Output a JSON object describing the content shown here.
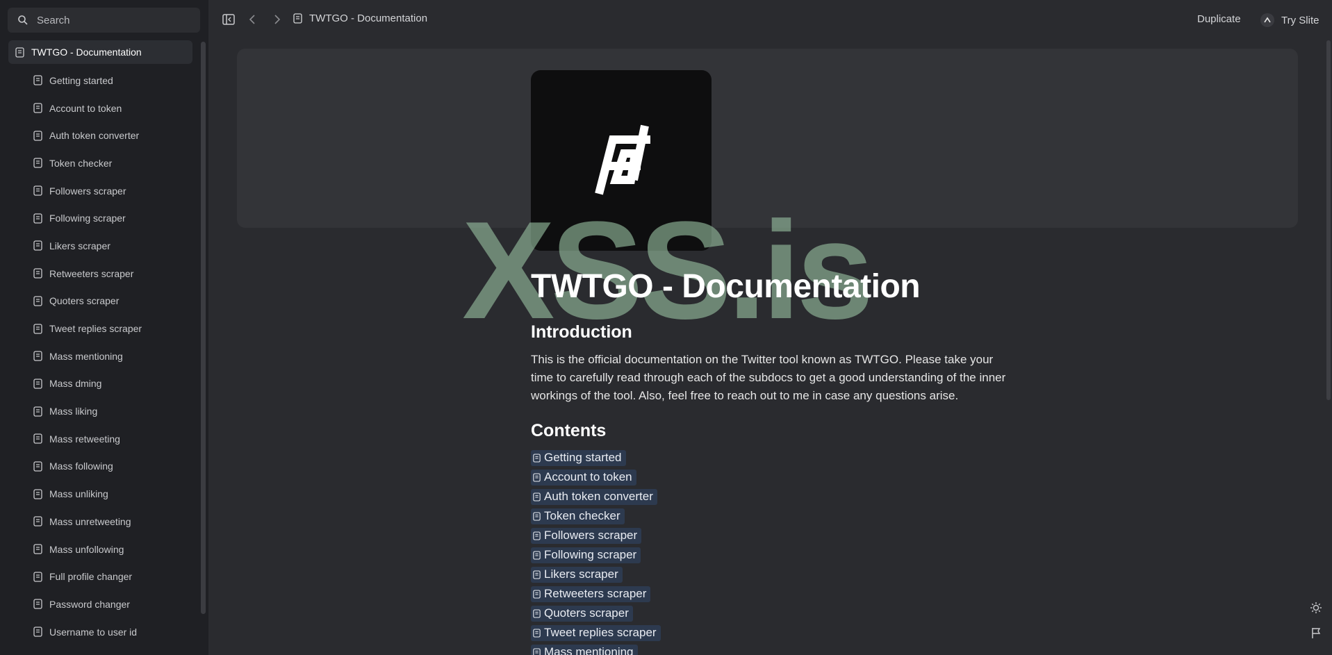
{
  "sidebar": {
    "search_placeholder": "Search",
    "root": {
      "label": "TWTGO - Documentation"
    },
    "items": [
      {
        "label": "Getting started"
      },
      {
        "label": "Account to token"
      },
      {
        "label": "Auth token converter"
      },
      {
        "label": "Token checker"
      },
      {
        "label": "Followers scraper"
      },
      {
        "label": "Following scraper"
      },
      {
        "label": "Likers scraper"
      },
      {
        "label": "Retweeters scraper"
      },
      {
        "label": "Quoters scraper"
      },
      {
        "label": "Tweet replies scraper"
      },
      {
        "label": "Mass mentioning"
      },
      {
        "label": "Mass dming"
      },
      {
        "label": "Mass liking"
      },
      {
        "label": "Mass retweeting"
      },
      {
        "label": "Mass following"
      },
      {
        "label": "Mass unliking"
      },
      {
        "label": "Mass unretweeting"
      },
      {
        "label": "Mass unfollowing"
      },
      {
        "label": "Full profile changer"
      },
      {
        "label": "Password changer"
      },
      {
        "label": "Username to user id"
      }
    ]
  },
  "topbar": {
    "breadcrumb": "TWTGO - Documentation",
    "duplicate_label": "Duplicate",
    "try_label": "Try Slite",
    "icons": [
      "sidebar-toggle-icon",
      "back-arrow-icon",
      "forward-arrow-icon",
      "document-icon"
    ]
  },
  "page": {
    "watermark": "XSS.is",
    "title": "TWTGO - Documentation",
    "intro_heading": "Introduction",
    "intro_text_1": "This is the official documentation on the Twitter tool known as TWTGO. Please take your time to carefully read through each of the subdocs to get a good understanding of the inner workings of the tool. Also, feel free to reach out to ",
    "intro_link": "me",
    "intro_text_2": " in case any questions arise.",
    "contents_heading": "Contents",
    "contents": [
      {
        "label": "Getting started"
      },
      {
        "label": "Account to token"
      },
      {
        "label": "Auth token converter"
      },
      {
        "label": "Token checker"
      },
      {
        "label": "Followers scraper"
      },
      {
        "label": "Following scraper"
      },
      {
        "label": "Likers scraper"
      },
      {
        "label": "Retweeters scraper"
      },
      {
        "label": "Quoters scraper"
      },
      {
        "label": "Tweet replies scraper"
      },
      {
        "label": "Mass mentioning"
      }
    ]
  },
  "colors": {
    "background": "#2a2b2f",
    "sidebar": "#1f2024",
    "link_chip": "#2d3a4f",
    "watermark": "#96bea0"
  }
}
